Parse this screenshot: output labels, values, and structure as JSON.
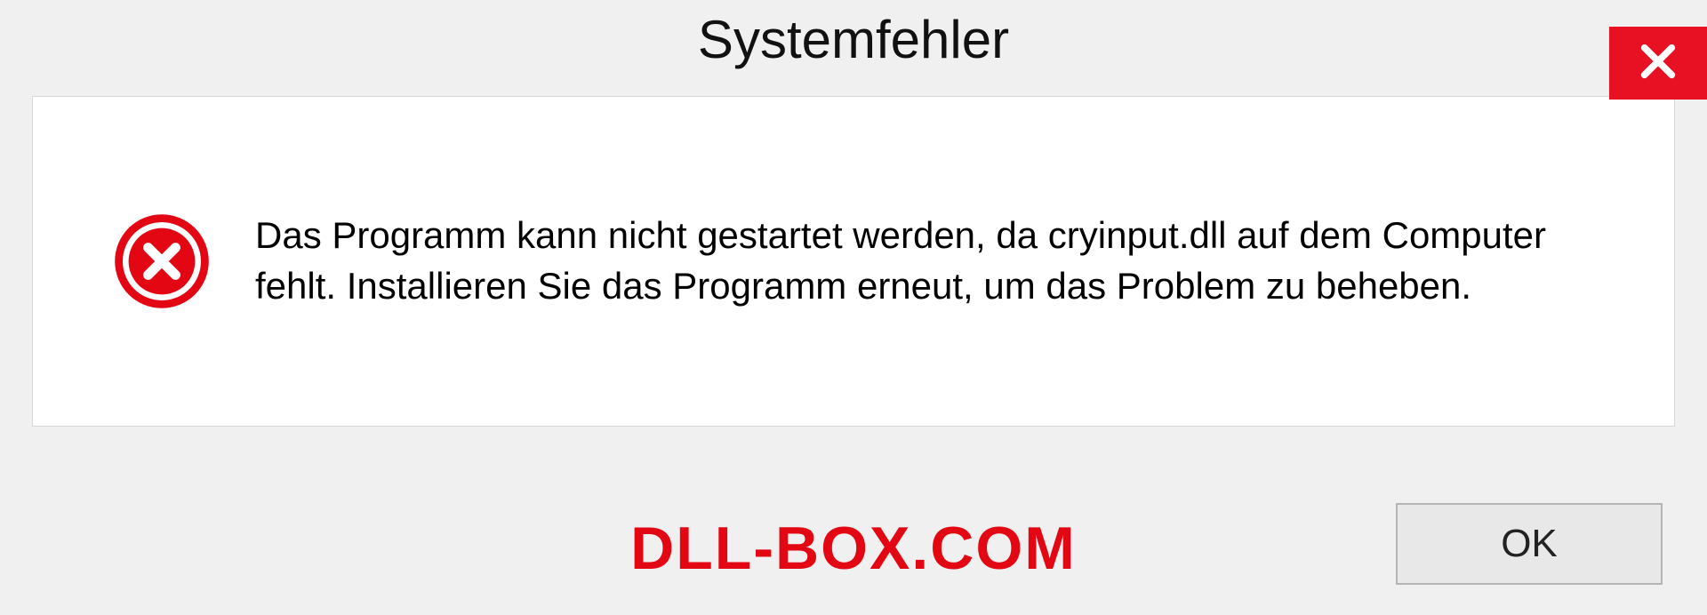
{
  "dialog": {
    "title": "Systemfehler",
    "message": "Das Programm kann nicht gestartet werden, da cryinput.dll auf dem Computer fehlt. Installieren Sie das Programm erneut, um das Problem zu beheben.",
    "ok_label": "OK"
  },
  "watermark": "DLL-BOX.COM"
}
